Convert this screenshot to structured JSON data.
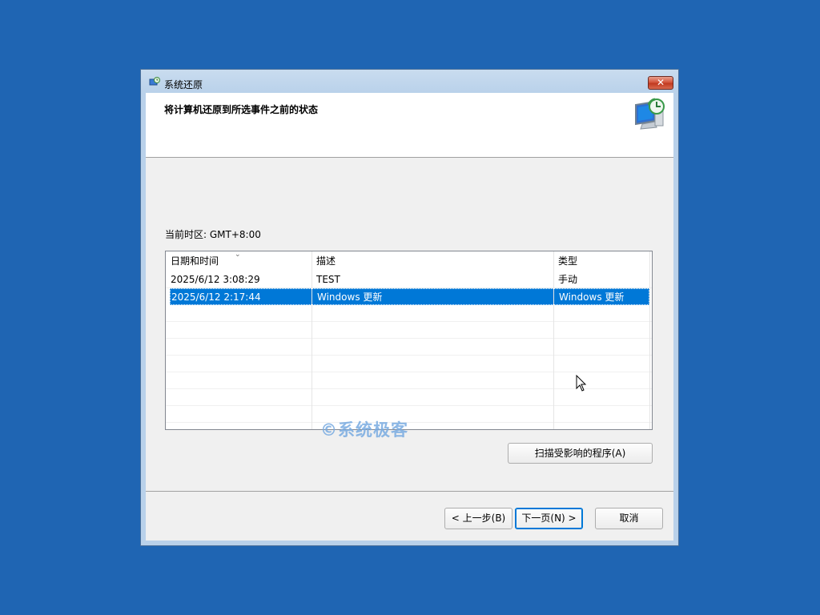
{
  "window": {
    "title": "系统还原",
    "close_label": "✕"
  },
  "header": {
    "title": "将计算机还原到所选事件之前的状态",
    "icon": "monitor-restore-icon"
  },
  "timezone_label": "当前时区: GMT+8:00",
  "table": {
    "columns": [
      "日期和时间",
      "描述",
      "类型"
    ],
    "rows": [
      {
        "date": "2025/6/12 3:08:29",
        "description": "TEST",
        "type": "手动",
        "selected": false
      },
      {
        "date": "2025/6/12 2:17:44",
        "description": "Windows 更新",
        "type": "Windows 更新",
        "selected": true
      }
    ]
  },
  "buttons": {
    "scan": "扫描受影响的程序(A)",
    "back": "< 上一步(B)",
    "next": "下一页(N) >",
    "cancel": "取消"
  },
  "watermark": "系统极客",
  "colors": {
    "desktop": "#1f65b3",
    "selection": "#0078d7"
  }
}
